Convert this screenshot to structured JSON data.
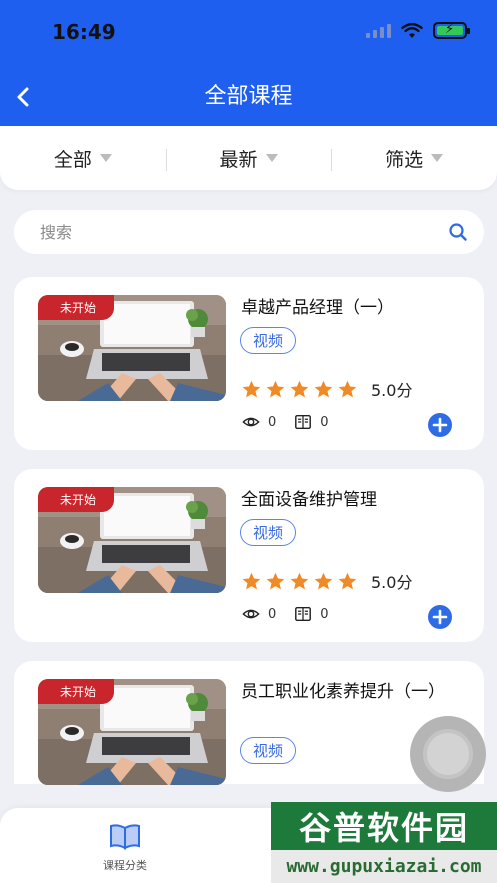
{
  "status": {
    "time": "16:49"
  },
  "header": {
    "title": "全部课程"
  },
  "filters": [
    {
      "label": "全部"
    },
    {
      "label": "最新"
    },
    {
      "label": "筛选"
    }
  ],
  "search": {
    "placeholder": "搜索"
  },
  "courses": [
    {
      "badge": "未开始",
      "title": "卓越产品经理（一）",
      "tag": "视频",
      "rating": 5,
      "score": "5.0分",
      "views": "0",
      "lessons": "0"
    },
    {
      "badge": "未开始",
      "title": "全面设备维护管理",
      "tag": "视频",
      "rating": 5,
      "score": "5.0分",
      "views": "0",
      "lessons": "0"
    },
    {
      "badge": "未开始",
      "title": "员工职业化素养提升（一）",
      "tag": "视频"
    }
  ],
  "tabbar": {
    "category_label": "课程分类"
  },
  "watermark": {
    "top": "谷普软件园",
    "bottom": "www.gupuxiazai.com"
  },
  "colors": {
    "primary": "#1f5ff0",
    "star": "#f08a24",
    "badge": "#c8252c",
    "add": "#2e6be6"
  },
  "icons": {
    "back": "chevron-left-icon",
    "search": "search-icon",
    "view": "eye-icon",
    "lesson": "book-icon",
    "add": "plus-circle-icon",
    "category": "open-book-icon"
  }
}
